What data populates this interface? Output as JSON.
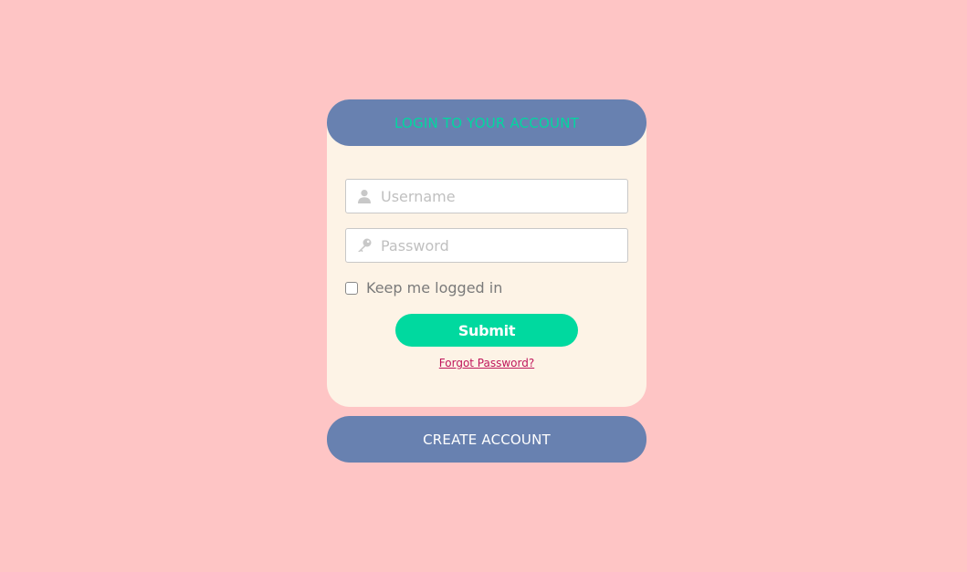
{
  "login": {
    "title": "LOGIN TO YOUR ACCOUNT",
    "username_placeholder": "Username",
    "username_value": "",
    "password_placeholder": "Password",
    "password_value": "",
    "remember_label": "Keep me logged in",
    "remember_checked": false,
    "submit_label": "Submit",
    "forgot_label": "Forgot Password?"
  },
  "create_account": {
    "label": "CREATE ACCOUNT"
  },
  "icons": {
    "username": "user-icon",
    "password": "key-icon"
  },
  "colors": {
    "background": "#fec5c5",
    "card": "#fdf3e6",
    "header": "#6881b0",
    "accent": "#00d99f",
    "link": "#c0175c"
  }
}
